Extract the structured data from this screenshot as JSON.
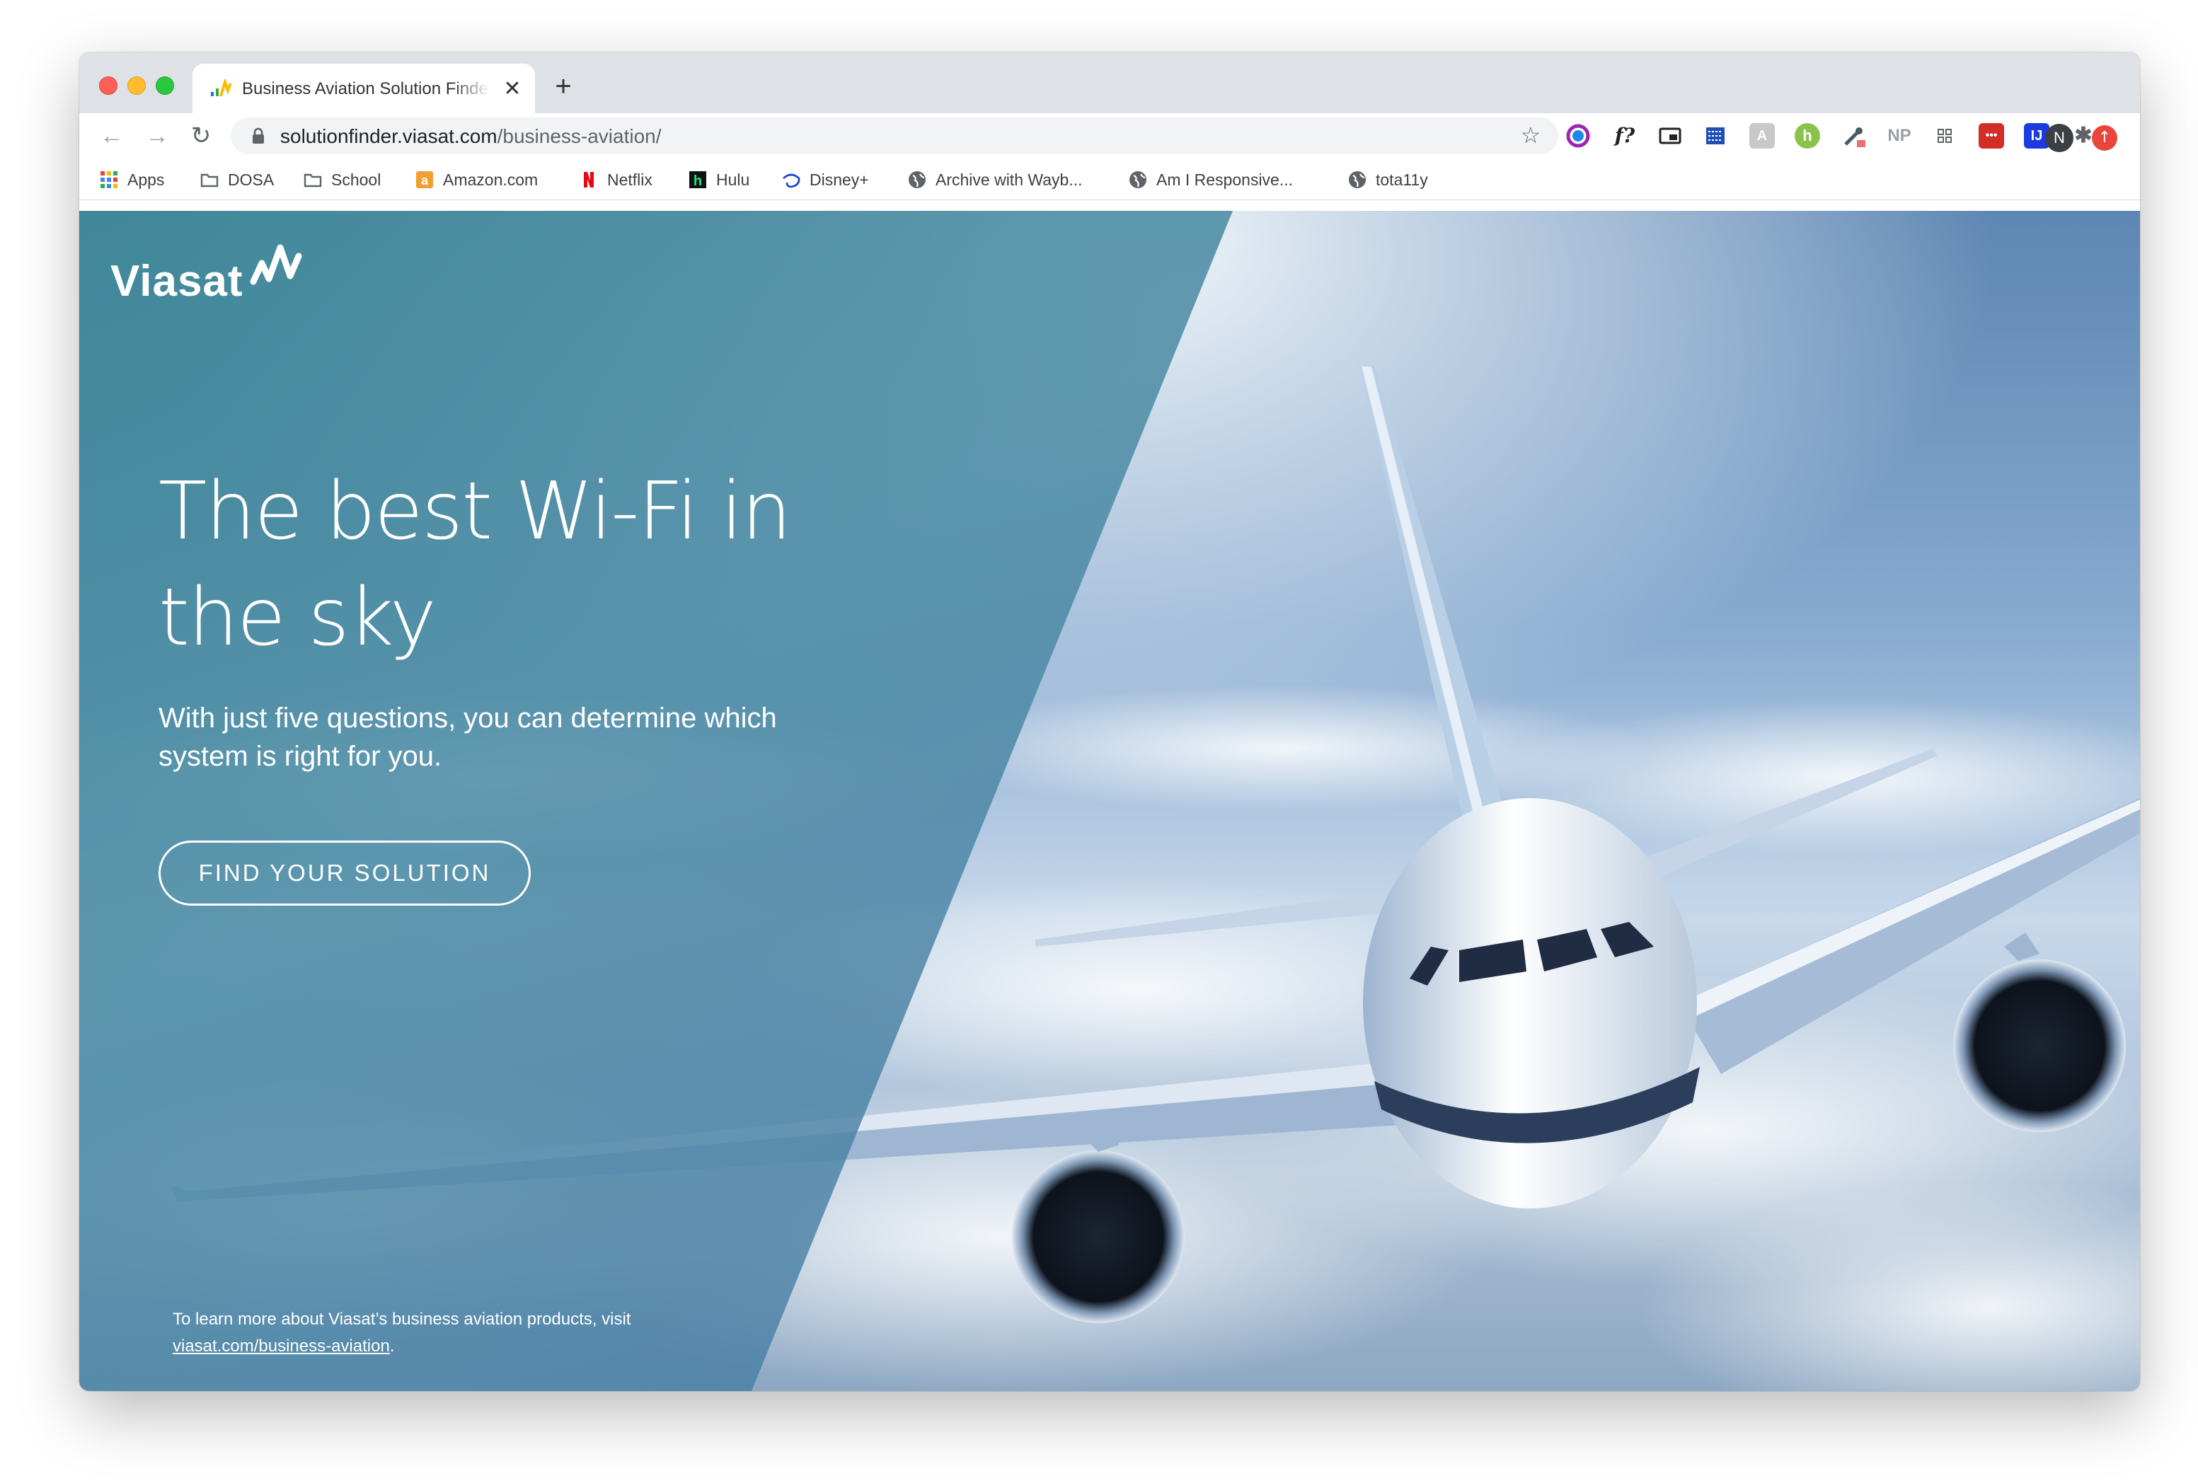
{
  "browser": {
    "tab": {
      "title": "Business Aviation Solution Finder",
      "close_glyph": "✕"
    },
    "new_tab_glyph": "+",
    "nav": {
      "back_glyph": "←",
      "forward_glyph": "→",
      "reload_glyph": "↻"
    },
    "address": {
      "domain": "solutionfinder.viasat.com",
      "path": "/business-aviation/"
    },
    "star_glyph": "☆",
    "extensions": [
      {
        "name": "color-picker-extension-icon",
        "label": ""
      },
      {
        "name": "font-finder-extension-icon",
        "label": "f?"
      },
      {
        "name": "picture-in-picture-extension-icon",
        "label": ""
      },
      {
        "name": "accessibility-extension-icon",
        "label": ""
      },
      {
        "name": "translate-extension-icon",
        "label": ""
      },
      {
        "name": "honey-extension-icon",
        "label": "h"
      },
      {
        "name": "eyedropper-extension-icon",
        "label": ""
      },
      {
        "name": "np-extension-icon",
        "label": "NP"
      },
      {
        "name": "grid-extension-icon",
        "label": ""
      },
      {
        "name": "lastpass-extension-icon",
        "label": "•••"
      },
      {
        "name": "ij-extension-icon",
        "label": "IJ"
      },
      {
        "name": "puzzle-extensions-icon",
        "label": ""
      }
    ],
    "profile_initial": "N",
    "bookmarks": [
      {
        "label": "Apps",
        "icon": "apps-grid-icon"
      },
      {
        "label": "DOSA",
        "icon": "folder-icon"
      },
      {
        "label": "School",
        "icon": "folder-icon"
      },
      {
        "label": "Amazon.com",
        "icon": "amazon-icon"
      },
      {
        "label": "Netflix",
        "icon": "netflix-icon"
      },
      {
        "label": "Hulu",
        "icon": "hulu-icon"
      },
      {
        "label": "Disney+",
        "icon": "disney-icon"
      },
      {
        "label": "Archive with Wayb...",
        "icon": "globe-icon"
      },
      {
        "label": "Am I Responsive...",
        "icon": "globe-icon"
      },
      {
        "label": "tota11y",
        "icon": "globe-icon"
      }
    ]
  },
  "page": {
    "logo_text": "Viasat",
    "hero_title": "The best Wi-Fi in the sky",
    "hero_subtitle": "With just five questions, you can determine which system is right for you.",
    "cta_label": "FIND YOUR SOLUTION",
    "footnote_text": "To learn more about Viasat’s business aviation products, visit",
    "footnote_link": "viasat.com/business-aviation",
    "footnote_end": "."
  },
  "colors": {
    "panel_teal": "#4b8ea0",
    "sky_blue": "#4f7aa6",
    "cloud_white": "#eef3f8",
    "accent_red": "#e8453c"
  }
}
